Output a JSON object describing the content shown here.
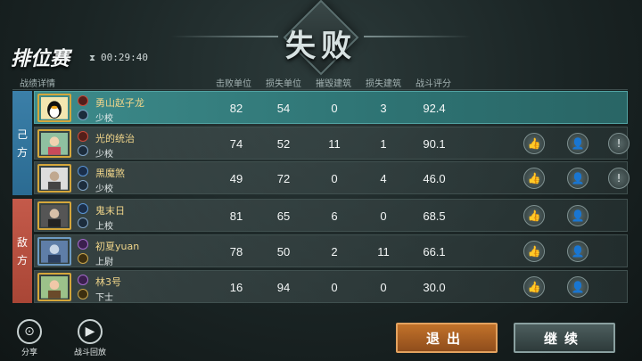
{
  "result_title": "失败",
  "mode_title": "排位赛",
  "timer": "00:29:40",
  "timer_icon": "hourglass-icon",
  "columns": {
    "details": "战绩详情",
    "kills": "击败单位",
    "losses": "损失单位",
    "destroyed_buildings": "摧毁建筑",
    "lost_buildings": "损失建筑",
    "score": "战斗评分"
  },
  "sides": {
    "ally": [
      "己",
      "方"
    ],
    "enemy": [
      "敌",
      "方"
    ]
  },
  "players": [
    {
      "name": "勇山赵子龙",
      "rank": "少校",
      "kills": "82",
      "losses": "54",
      "destroyed": "0",
      "lost": "3",
      "score": "92.4"
    },
    {
      "name": "光的统治",
      "rank": "少校",
      "kills": "74",
      "losses": "52",
      "destroyed": "11",
      "lost": "1",
      "score": "90.1"
    },
    {
      "name": "黑魔煞",
      "rank": "少校",
      "kills": "49",
      "losses": "72",
      "destroyed": "0",
      "lost": "4",
      "score": "46.0"
    },
    {
      "name": "鬼末日",
      "rank": "上校",
      "kills": "81",
      "losses": "65",
      "destroyed": "6",
      "lost": "0",
      "score": "68.5"
    },
    {
      "name": "初夏yuan",
      "rank": "上尉",
      "kills": "78",
      "losses": "50",
      "destroyed": "2",
      "lost": "11",
      "score": "66.1"
    },
    {
      "name": "林3号",
      "rank": "下士",
      "kills": "16",
      "losses": "94",
      "destroyed": "0",
      "lost": "0",
      "score": "30.0"
    }
  ],
  "actions": {
    "like_icon": "thumbs-up-icon",
    "add_friend_icon": "add-friend-icon",
    "report_icon": "report-icon"
  },
  "bottom": {
    "share": "分享",
    "replay": "战斗回放",
    "exit": "退出",
    "continue": "继续"
  },
  "colors": {
    "ally": "#3b7fa8",
    "enemy": "#c45a4a",
    "highlight": "#3d8b8b",
    "exit_button": "#c2722a"
  }
}
